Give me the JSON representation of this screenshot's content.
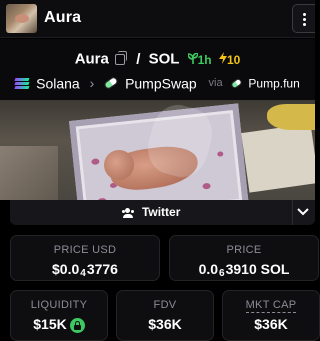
{
  "header": {
    "title": "Aura"
  },
  "token": {
    "symbol": "Aura",
    "quote": "SOL",
    "separator": "/",
    "age": "1h",
    "boosts": "10"
  },
  "route": {
    "chain": "Solana",
    "dex": "PumpSwap",
    "via_label": "via",
    "launchpad": "Pump.fun"
  },
  "social": {
    "twitter_label": "Twitter"
  },
  "stats": {
    "price_usd": {
      "label": "PRICE USD",
      "prefix": "$0.0",
      "zeros": "4",
      "digits": "3776"
    },
    "price_native": {
      "label": "PRICE",
      "prefix": "0.0",
      "zeros": "6",
      "digits": "3910 SOL"
    },
    "liquidity": {
      "label": "LIQUIDITY",
      "value": "$15K"
    },
    "fdv": {
      "label": "FDV",
      "value": "$36K"
    },
    "mkt_cap": {
      "label": "MKT CAP",
      "value": "$36K"
    }
  },
  "colors": {
    "accent_green": "#3cc962",
    "boost_yellow": "#f2c417",
    "background": "#000000"
  },
  "icons": [
    "more-icon",
    "copy-icon",
    "seedling-icon",
    "bolt-icon",
    "solana-icon",
    "chevron-right-icon",
    "pumpswap-icon",
    "pumpfun-icon",
    "users-icon",
    "chevron-down-icon",
    "lock-icon"
  ]
}
